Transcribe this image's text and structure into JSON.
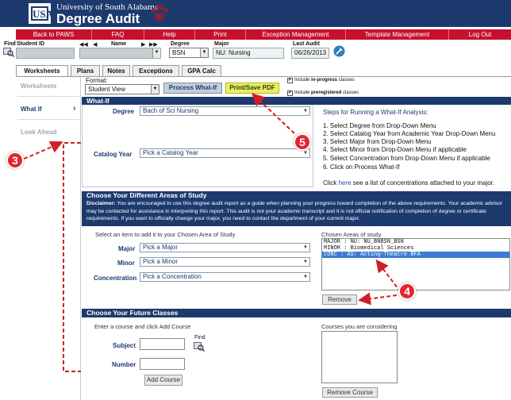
{
  "header": {
    "logo": "USA",
    "university": "University of South Alabama",
    "title": "Degree Audit",
    "mascot_icon": "paw-icon"
  },
  "nav": [
    {
      "label": "Back to PAWS"
    },
    {
      "label": "FAQ"
    },
    {
      "label": "Help"
    },
    {
      "label": "Print"
    },
    {
      "label": "Exception Management"
    },
    {
      "label": "Template Management"
    },
    {
      "label": "Log Out"
    }
  ],
  "student": {
    "find_label": "Find",
    "id_label": "Student ID",
    "name_label": "Name",
    "degree_label": "Degree",
    "degree_value": "BSN",
    "major_label": "Major",
    "major_value": "NU: Nursing",
    "last_audit_label": "Last Audit",
    "last_audit_value": "06/26/2013",
    "first_icon": "◀◀",
    "prev_icon": "◀",
    "next_icon": "▶",
    "last_icon": "▶▶"
  },
  "tabs": [
    "Worksheets",
    "Plans",
    "Notes",
    "Exceptions",
    "GPA Calc"
  ],
  "side": [
    "Worksheets",
    "What If",
    "Look Ahead"
  ],
  "toolbar": {
    "format_label": "Format:",
    "format_value": "Student View",
    "process_button": "Process What-If",
    "print_button": "Print/Save PDF",
    "include_inprogress_pre": "Include ",
    "include_inprogress_bold": "in-progress",
    "include_inprogress_post": " classes",
    "include_prereg_pre": "Include ",
    "include_prereg_bold": "preregistered",
    "include_prereg_post": " classes"
  },
  "whatif": {
    "header": "What-If",
    "degree_label": "Degree",
    "degree_value": "Bach of Sci Nursing",
    "catalog_label": "Catalog Year",
    "catalog_value": "Pick a Catalog Year",
    "steps_title": "Steps for Running a What-If Analysis:",
    "steps": [
      "1. Select Degree from Drop-Down Menu",
      "2. Select Catalog Year from Academic Year Drop-Down Menu",
      "3. Select Major from Drop-Down Menu",
      "4. Select Minor from Drop-Down Menu if applicable",
      "5. Select Concentration from Drop-Down Menu if applicable",
      "6. Click on Process What-If"
    ],
    "click_pre": "Click ",
    "click_link": "here",
    "click_post": " see a list of concentrations attached to your major."
  },
  "areas": {
    "header": "Choose Your Different Areas of Study",
    "disclaimer_label": "Disclaimer:",
    "disclaimer_text": "You are encouraged to use this degree audit report as a guide when planning your progress toward completion of the above requirements. Your academic advisor may be contacted for assistance in interpreting this report. This audit is not your academic transcript and it is not official notification of completion of degree or certificate requirements. If you want to officially change your major, you need to contact the department of your current major.",
    "select_prompt": "Select an item to add it to your Chosen Area of Study",
    "major_label": "Major",
    "major_value": "Pick a Major",
    "minor_label": "Minor",
    "minor_value": "Pick a Minor",
    "conc_label": "Concentration",
    "conc_value": "Pick a Concentration",
    "chosen_label": "Chosen Areas of study",
    "chosen": [
      "MAJOR : NU: NU_BNBSN_BSN",
      "MINOR : Biomedical Sciences",
      "CONC : AS: Acting-Theatre BFA"
    ],
    "remove_button": "Remove"
  },
  "future": {
    "header": "Choose Your Future Classes",
    "prompt": "Enter a course and click Add Course",
    "subject_label": "Subject",
    "number_label": "Number",
    "find_label": "Find",
    "add_button": "Add Course",
    "considering_label": "Courses you are considering",
    "remove_button": "Remove Course"
  },
  "callouts": [
    "3",
    "4",
    "5"
  ],
  "colors": {
    "navy": "#1d3a6e",
    "red": "#c8102e",
    "highlight": "#3a7bd5",
    "callout": "#e3262f"
  }
}
